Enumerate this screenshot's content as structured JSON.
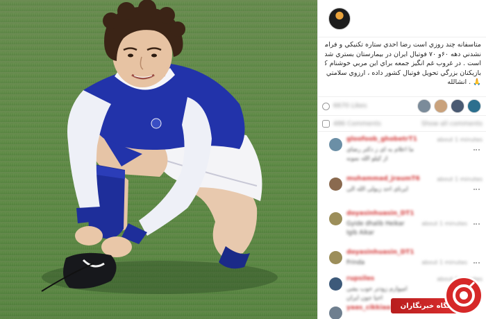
{
  "post": {
    "caption_lines": [
      "متاسفانه چند روزي است رضا احدي ستاره تكنيكي و فراموش",
      "نشدني دهه ۶۰و ۷۰ فوتبال ايران در بيمارستان بستري شده",
      "است . در غروب غم انگيز جمعه براي اين مربي خوشنام كه",
      "بازيكنان بزرگي تحويل فوتبال كشور داده ، ارزوي سلامتي دارم",
      "🙏 . انشالله"
    ],
    "likes_text": "6670 Likes",
    "comments_count_text": "486 Comments",
    "show_all_text": "Show all comments",
    "comments": [
      {
        "user": "gloofoob_ghobetrT1",
        "time": "about 1 minutes",
        "text1": "ما اعلام به ای ز دکتر رضای",
        "text2": "از کیلو الله نمونه"
      },
      {
        "user": "muhammad_jraumT6",
        "time": "about 1 minutes",
        "text1": "ایرنای احد زبولی الله الی",
        "text2": ""
      },
      {
        "user": "doyasinhuasin_DT1",
        "time": "about 1 minutes",
        "text1": "Gyide dhalib Heikar",
        "text2": "Igib Aikar"
      },
      {
        "user": "doyasinhuasin_DT1",
        "time": "about 1 minutes",
        "text1": "Frinda",
        "text2": ""
      },
      {
        "user": "rupsiles",
        "time": "about 1 minutes",
        "text1": "امیوارم زودتر خوب بشی",
        "text2": "اخیا جون ایران"
      },
      {
        "user": "yaas_cikkiaa1234_UAT1",
        "time": "",
        "text1": "",
        "text2": ""
      }
    ]
  },
  "watermark": {
    "label": "باشگاه خبرنگاران"
  },
  "colors": {
    "accent_red": "#d62828",
    "username_red": "#d43a3a",
    "jersey_blue": "#2233aa"
  }
}
